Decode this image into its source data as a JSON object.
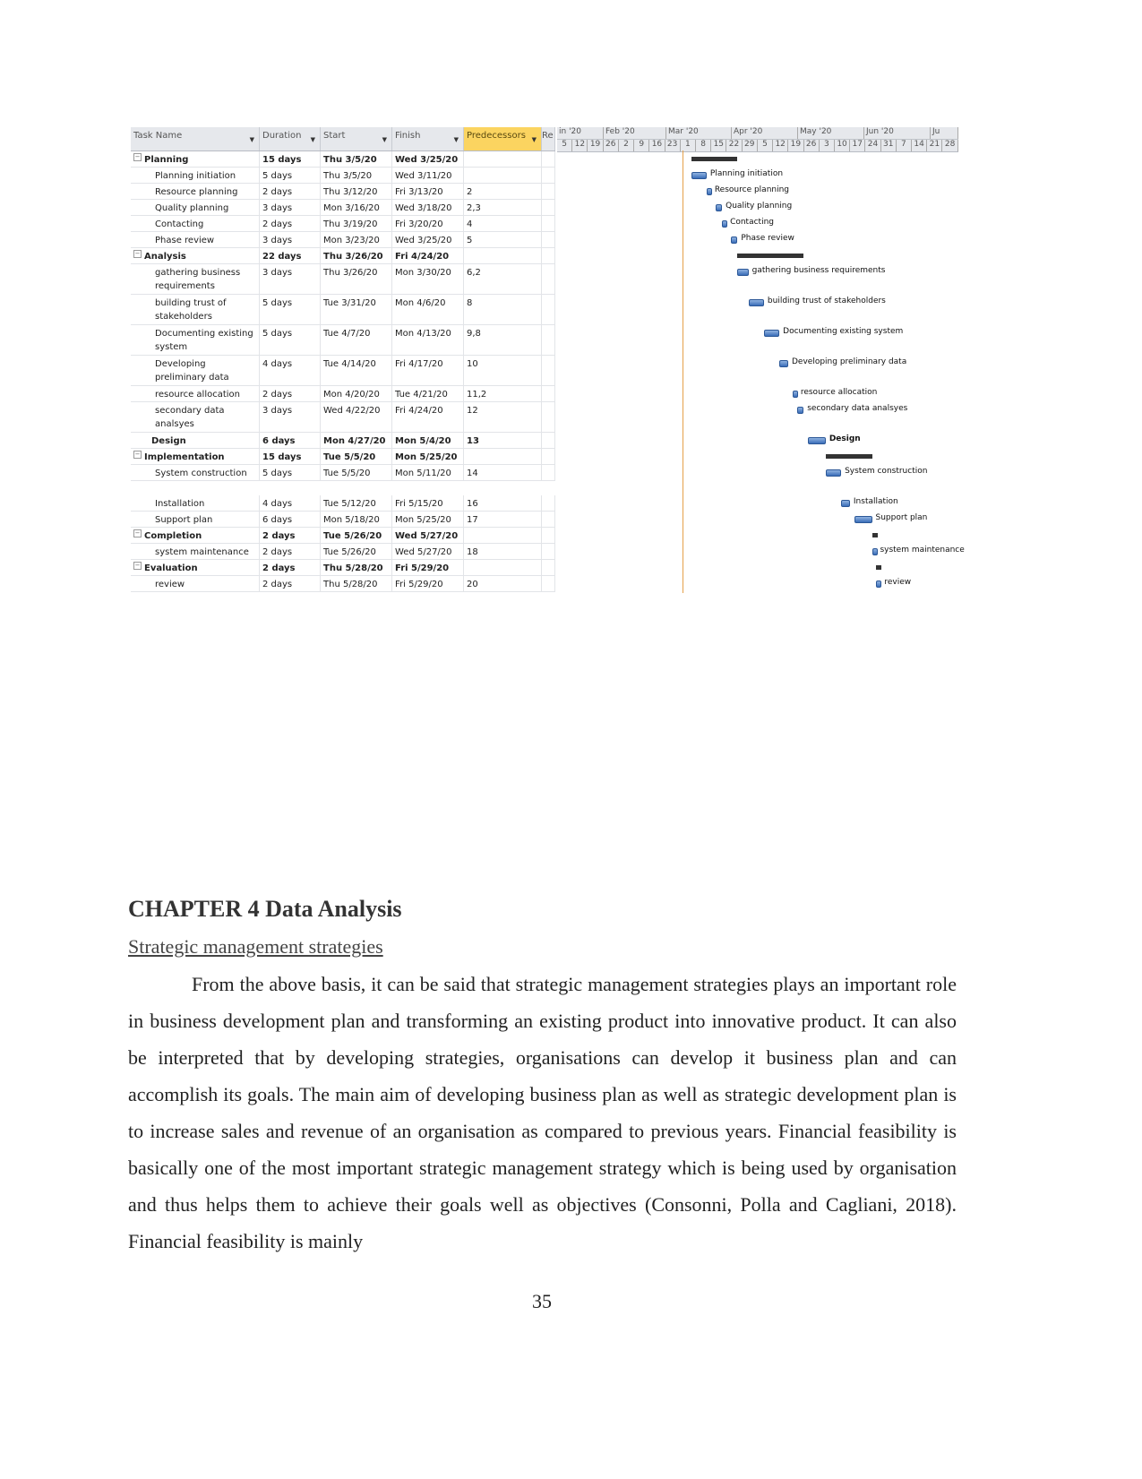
{
  "gantt_table": {
    "columns": [
      "Task Name",
      "Duration",
      "Start",
      "Finish",
      "Predecessors",
      "Re"
    ],
    "rows": [
      {
        "name": "Planning",
        "duration": "15 days",
        "start": "Thu 3/5/20",
        "finish": "Wed 3/25/20",
        "pred": "",
        "summary": true
      },
      {
        "name": "Planning initiation",
        "duration": "5 days",
        "start": "Thu 3/5/20",
        "finish": "Wed 3/11/20",
        "pred": ""
      },
      {
        "name": "Resource planning",
        "duration": "2 days",
        "start": "Thu 3/12/20",
        "finish": "Fri 3/13/20",
        "pred": "2"
      },
      {
        "name": "Quality planning",
        "duration": "3 days",
        "start": "Mon 3/16/20",
        "finish": "Wed 3/18/20",
        "pred": "2,3"
      },
      {
        "name": "Contacting",
        "duration": "2 days",
        "start": "Thu 3/19/20",
        "finish": "Fri 3/20/20",
        "pred": "4"
      },
      {
        "name": "Phase review",
        "duration": "3 days",
        "start": "Mon 3/23/20",
        "finish": "Wed 3/25/20",
        "pred": "5"
      },
      {
        "name": "Analysis",
        "duration": "22 days",
        "start": "Thu 3/26/20",
        "finish": "Fri 4/24/20",
        "pred": "",
        "summary": true
      },
      {
        "name": "gathering business requirements",
        "duration": "3 days",
        "start": "Thu 3/26/20",
        "finish": "Mon 3/30/20",
        "pred": "6,2",
        "tall": true
      },
      {
        "name": "building trust of stakeholders",
        "duration": "5 days",
        "start": "Tue 3/31/20",
        "finish": "Mon 4/6/20",
        "pred": "8",
        "tall": true
      },
      {
        "name": "Documenting existing system",
        "duration": "5 days",
        "start": "Tue 4/7/20",
        "finish": "Mon 4/13/20",
        "pred": "9,8",
        "tall": true
      },
      {
        "name": "Developing preliminary data",
        "duration": "4 days",
        "start": "Tue 4/14/20",
        "finish": "Fri 4/17/20",
        "pred": "10",
        "tall": true
      },
      {
        "name": "resource allocation",
        "duration": "2 days",
        "start": "Mon 4/20/20",
        "finish": "Tue 4/21/20",
        "pred": "11,2"
      },
      {
        "name": "secondary data analsyes",
        "duration": "3 days",
        "start": "Wed 4/22/20",
        "finish": "Fri 4/24/20",
        "pred": "12",
        "tall": true
      },
      {
        "name": "Design",
        "duration": "6 days",
        "start": "Mon 4/27/20",
        "finish": "Mon 5/4/20",
        "pred": "13",
        "summary": true,
        "noToggle": true,
        "blue": true
      },
      {
        "name": "Implementation",
        "duration": "15 days",
        "start": "Tue 5/5/20",
        "finish": "Mon 5/25/20",
        "pred": "",
        "summary": true
      },
      {
        "name": "System construction",
        "duration": "5 days",
        "start": "Tue 5/5/20",
        "finish": "Mon 5/11/20",
        "pred": "14"
      },
      {
        "name": "Installation",
        "duration": "4 days",
        "start": "Tue 5/12/20",
        "finish": "Fri 5/15/20",
        "pred": "16",
        "gap": true
      },
      {
        "name": "Support plan",
        "duration": "6 days",
        "start": "Mon 5/18/20",
        "finish": "Mon 5/25/20",
        "pred": "17"
      },
      {
        "name": "Completion",
        "duration": "2 days",
        "start": "Tue 5/26/20",
        "finish": "Wed 5/27/20",
        "pred": "",
        "summary": true
      },
      {
        "name": "system maintenance",
        "duration": "2 days",
        "start": "Tue 5/26/20",
        "finish": "Wed 5/27/20",
        "pred": "18"
      },
      {
        "name": "Evaluation",
        "duration": "2 days",
        "start": "Thu 5/28/20",
        "finish": "Fri 5/29/20",
        "pred": "",
        "summary": true
      },
      {
        "name": "review",
        "duration": "2 days",
        "start": "Thu 5/28/20",
        "finish": "Fri 5/29/20",
        "pred": "20"
      }
    ]
  },
  "timeline": {
    "months": [
      "in '20",
      "Feb '20",
      "Mar '20",
      "Apr '20",
      "May '20",
      "Jun '20",
      "Ju"
    ],
    "weeks": [
      "5",
      "12",
      "19",
      "26",
      "2",
      "9",
      "16",
      "23",
      "1",
      "8",
      "15",
      "22",
      "29",
      "5",
      "12",
      "19",
      "26",
      "3",
      "10",
      "17",
      "24",
      "31",
      "7",
      "14",
      "21",
      "28"
    ]
  },
  "colors": {
    "bar": "#3a6db8",
    "summary": "#333333",
    "predecessor_header": "#fbd460"
  },
  "body": {
    "chapter": "CHAPTER 4 Data Analysis",
    "section": "Strategic management strategies",
    "paragraph": "From the above basis, it can be said that strategic management strategies plays an important role in business development plan and transforming an existing product into innovative product. It can also be interpreted that by developing strategies, organisations can develop it business plan and can accomplish its goals. The main aim of developing business plan as well as strategic development plan is to increase sales and revenue of an organisation as compared to previous years. Financial feasibility is basically one of the most important strategic management strategy which is being used by organisation and thus helps them to achieve their goals well as objectives (Consonni, Polla and Cagliani, 2018). Financial feasibility is mainly",
    "page_number": "35"
  }
}
